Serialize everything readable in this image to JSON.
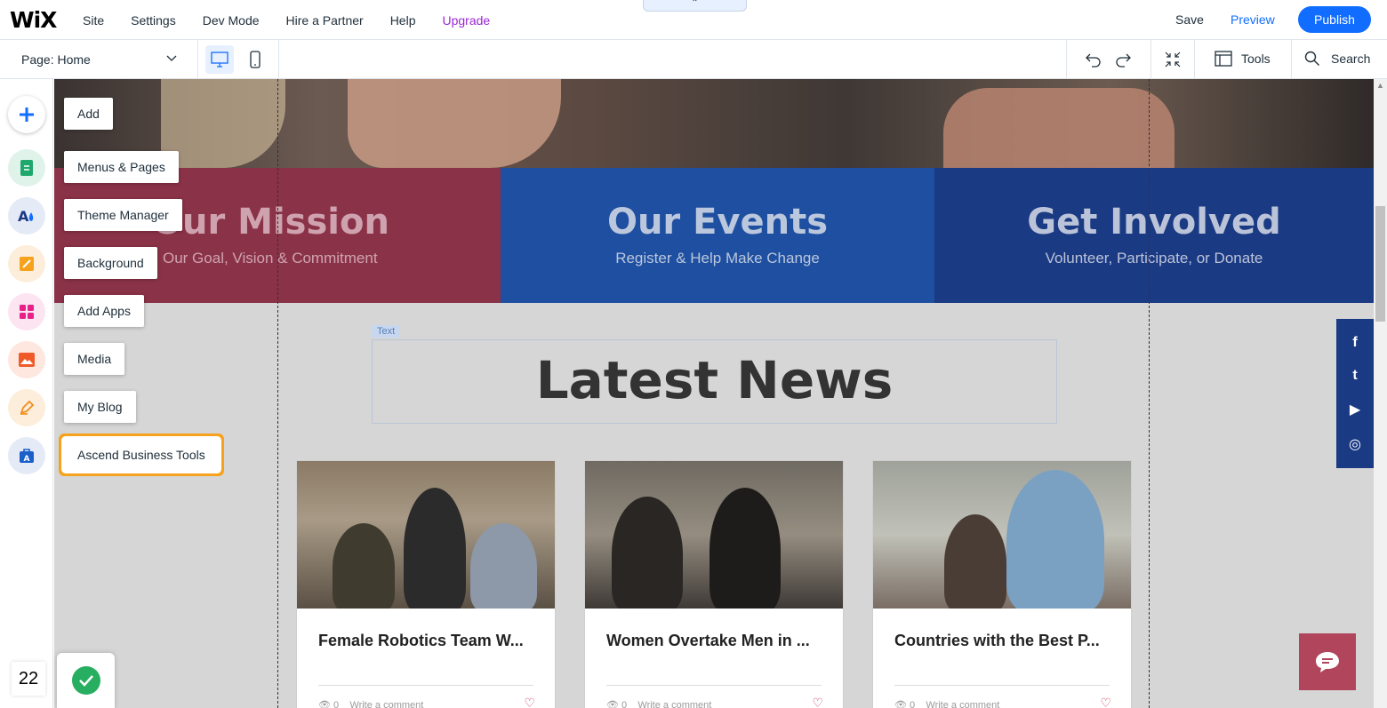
{
  "topbar": {
    "logo": "WiX",
    "menu": [
      "Site",
      "Settings",
      "Dev Mode",
      "Hire a Partner",
      "Help",
      "Upgrade"
    ],
    "collapse": "⌃",
    "save": "Save",
    "preview": "Preview",
    "publish": "Publish",
    "accent": "#116dff",
    "upgrade_color": "#9a27d5"
  },
  "subbar": {
    "page_label": "Page: Home",
    "tools": "Tools",
    "search": "Search"
  },
  "rail": {
    "items": [
      {
        "label": "Add",
        "icon": "plus-icon"
      },
      {
        "label": "Menus & Pages",
        "icon": "pages-icon"
      },
      {
        "label": "Theme Manager",
        "icon": "theme-icon"
      },
      {
        "label": "Background",
        "icon": "background-icon"
      },
      {
        "label": "Add Apps",
        "icon": "apps-icon"
      },
      {
        "label": "Media",
        "icon": "media-icon"
      },
      {
        "label": "My Blog",
        "icon": "blog-icon"
      },
      {
        "label": "Ascend Business Tools",
        "icon": "ascend-icon"
      }
    ]
  },
  "canvas": {
    "panels": [
      {
        "title": "Our Mission",
        "subtitle": "Our Goal, Vision & Commitment"
      },
      {
        "title": "Our Events",
        "subtitle": "Register & Help Make Change"
      },
      {
        "title": "Get Involved",
        "subtitle": "Volunteer, Participate, or Donate"
      }
    ],
    "text_tag": "Text",
    "headline": "Latest News",
    "cards": [
      {
        "title": "Female Robotics Team W...",
        "views": "0",
        "comment": "Write a comment"
      },
      {
        "title": "Women Overtake Men in ...",
        "views": "0",
        "comment": "Write a comment"
      },
      {
        "title": "Countries with the Best P...",
        "views": "0",
        "comment": "Write a comment"
      }
    ],
    "social": [
      "f",
      "t",
      "▶",
      "◎"
    ]
  },
  "bottom": {
    "page_count": "22"
  }
}
